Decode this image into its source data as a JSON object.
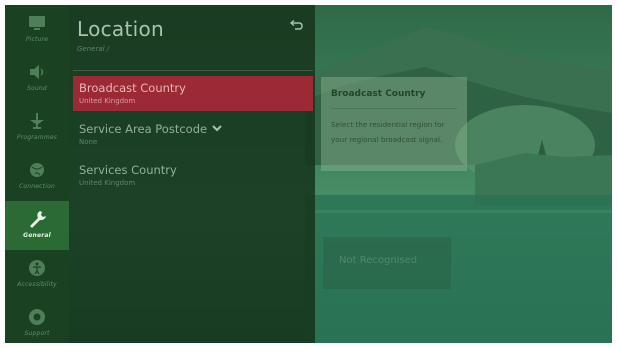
{
  "sidebar": {
    "items": [
      {
        "label": "Picture",
        "icon": "monitor-icon"
      },
      {
        "label": "Sound",
        "icon": "speaker-icon"
      },
      {
        "label": "Programmes",
        "icon": "antenna-icon"
      },
      {
        "label": "Connection",
        "icon": "globe-icon"
      },
      {
        "label": "General",
        "icon": "wrench-icon",
        "active": true
      },
      {
        "label": "Accessibility",
        "icon": "accessibility-icon"
      },
      {
        "label": "Support",
        "icon": "support-icon"
      }
    ]
  },
  "panel": {
    "title": "Location",
    "breadcrumb": "General /",
    "back_icon": "back-arrow-icon",
    "items": [
      {
        "label": "Broadcast Country",
        "value": "United Kingdom",
        "selected": true
      },
      {
        "label": "Service Area Postcode",
        "value": "None",
        "expand_icon": "chevron-down-icon"
      },
      {
        "label": "Services Country",
        "value": "United Kingdom"
      }
    ]
  },
  "tooltip": {
    "title": "Broadcast Country",
    "description": "Select the residential region for your regional broadcast signal."
  },
  "background_button": {
    "label": "Not Recognised"
  },
  "colors": {
    "overlay": "#1a4222",
    "selected_row": "#9c2a34",
    "active_sidebar": "#2b6a34"
  }
}
